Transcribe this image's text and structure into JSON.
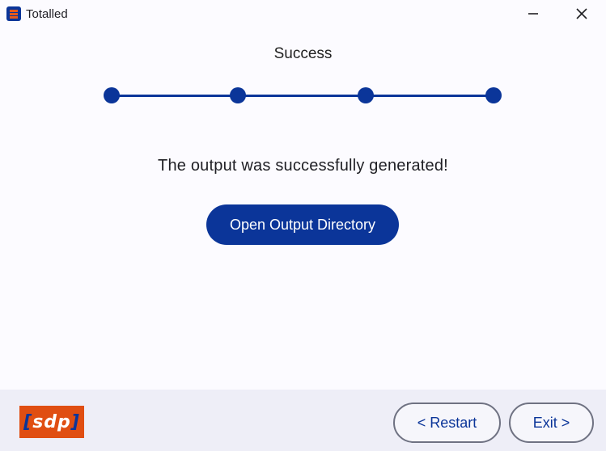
{
  "window": {
    "title": "Totalled"
  },
  "stepper": {
    "title": "Success",
    "total_steps": 4,
    "completed_steps": 4,
    "accent_color": "#0b3599"
  },
  "main": {
    "message": "The output was successfully generated!",
    "open_dir_label": "Open Output Directory"
  },
  "footer": {
    "logo_text": "sdp",
    "restart_label": "< Restart",
    "exit_label": "Exit >"
  },
  "colors": {
    "primary": "#0b3599",
    "logo_bg": "#e04e12",
    "footer_bg": "#eeeef7",
    "window_bg": "#fcfbff"
  },
  "icons": {
    "app": "app-icon",
    "minimize": "minimize-icon",
    "close": "close-icon"
  }
}
